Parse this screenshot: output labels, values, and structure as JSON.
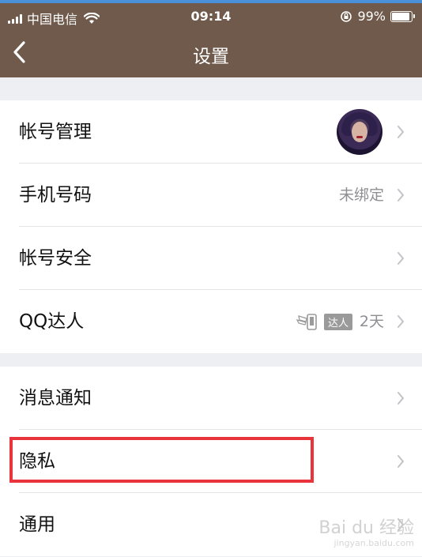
{
  "status_bar": {
    "carrier": "中国电信",
    "time": "09:14",
    "battery_text": "99%",
    "battery_level": 0.99
  },
  "nav": {
    "title": "设置",
    "back_icon": "chevron-left-icon"
  },
  "groups": [
    {
      "rows": [
        {
          "label": "帐号管理",
          "accessory": "avatar"
        },
        {
          "label": "手机号码",
          "value": "未绑定"
        },
        {
          "label": "帐号安全"
        },
        {
          "label": "QQ达人",
          "badge": "达人",
          "value": "2天"
        }
      ]
    },
    {
      "rows": [
        {
          "label": "消息通知"
        },
        {
          "label": "隐私"
        },
        {
          "label": "通用"
        }
      ]
    }
  ],
  "watermark": {
    "text": "Bai du 经验",
    "sub": "jingyan.baidu.com"
  },
  "colors": {
    "header": "#6f5a4c",
    "highlight": "#e8343a",
    "background": "#eeeff3"
  }
}
